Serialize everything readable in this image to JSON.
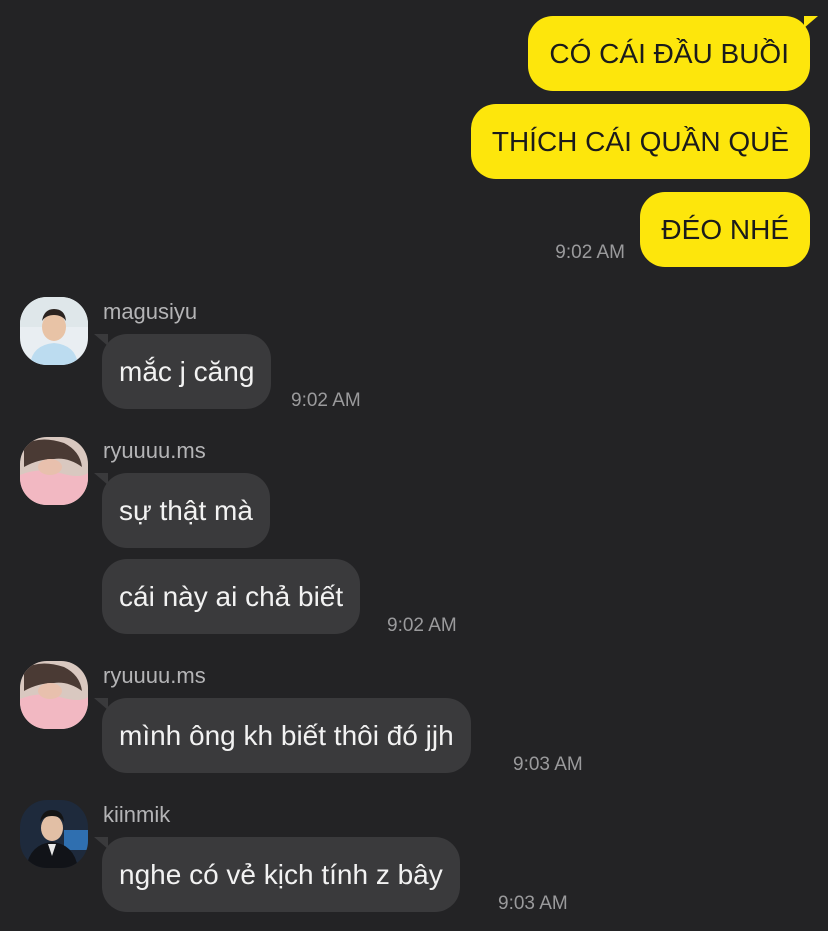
{
  "outgoing": {
    "messages": [
      "CÓ CÁI ĐẦU BUỒI",
      "THÍCH CÁI QUẦN QUÈ",
      "ĐÉO NHÉ"
    ],
    "time": "9:02 AM"
  },
  "groups": [
    {
      "username": "magusiyu",
      "avatar_icon": "user-avatar-photo",
      "messages": [
        "mắc j căng"
      ],
      "time": "9:02 AM"
    },
    {
      "username": "ryuuuu.ms",
      "avatar_icon": "user-avatar-photo",
      "messages": [
        "sự thật mà",
        "cái này ai chả biết"
      ],
      "time": "9:02 AM"
    },
    {
      "username": "ryuuuu.ms",
      "avatar_icon": "user-avatar-photo",
      "messages": [
        "mình ông kh biết thôi đó jjh"
      ],
      "time": "9:03 AM"
    },
    {
      "username": "kiinmik",
      "avatar_icon": "user-avatar-photo",
      "messages": [
        "nghe có vẻ kịch tính z bây"
      ],
      "time": "9:03 AM"
    }
  ],
  "colors": {
    "background": "#232325",
    "outgoing_bubble": "#fde60c",
    "incoming_bubble": "#3a3a3c",
    "timestamp": "#9a9a9c",
    "username": "#b4b4b6"
  }
}
